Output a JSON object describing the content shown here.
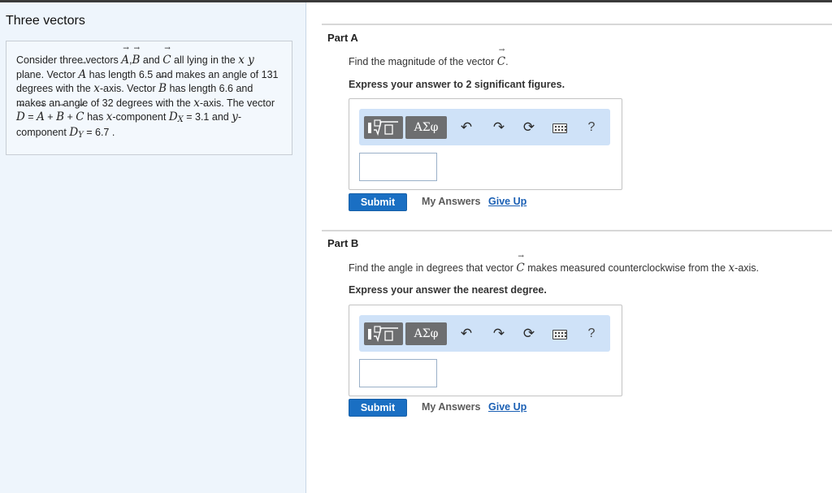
{
  "problem": {
    "title": "Three vectors",
    "t1": "Consider three vectors ",
    "vA": "A",
    "comma": ",",
    "vB": "B",
    "t2": " and ",
    "vC": "C",
    "t3": " all lying in the ",
    "xy": "x y",
    "t4": " plane. Vector ",
    "t5": " has length 6.5 and makes an angle of 131 degrees with the ",
    "x": "x",
    "t6": "-axis. Vector ",
    "t7": " has length 6.6 and makes an angle of 32 degrees with the ",
    "t8": "-axis. The vector ",
    "vD": "D",
    "eq": " = ",
    "plus": " + ",
    "t9": " has ",
    "t10": "-component ",
    "sx": "X",
    "dx_val": " = 3.1",
    "t11": " and ",
    "y": "y",
    "t12": "-component ",
    "sy": "Y",
    "dy_val": " = 6.7 ."
  },
  "part_a": {
    "label": "Part A",
    "prompt": "Find the magnitude of the vector ",
    "vec": "C",
    "end": ".",
    "instruction": "Express your answer to 2 significant figures."
  },
  "part_b": {
    "label": "Part B",
    "prompt_1": "Find the angle in degrees that vector ",
    "vec": "C",
    "prompt_2": " makes measured counterclockwise from the ",
    "x": "x",
    "prompt_3": "-axis.",
    "instruction": "Express your answer the nearest degree."
  },
  "toolbar": {
    "greek": "ΑΣφ",
    "help": "?",
    "icons": [
      "templates-icon",
      "undo-icon",
      "redo-icon",
      "reset-icon",
      "keyboard-icon",
      "help-icon"
    ]
  },
  "actions": {
    "submit": "Submit",
    "my_answers": "My Answers",
    "give_up": "Give Up"
  },
  "colors": {
    "left_pane_bg": "#eef5fc",
    "toolbar_bg": "#cfe2f8",
    "submit_bg": "#1a6fc3",
    "link": "#1a5fb4"
  }
}
